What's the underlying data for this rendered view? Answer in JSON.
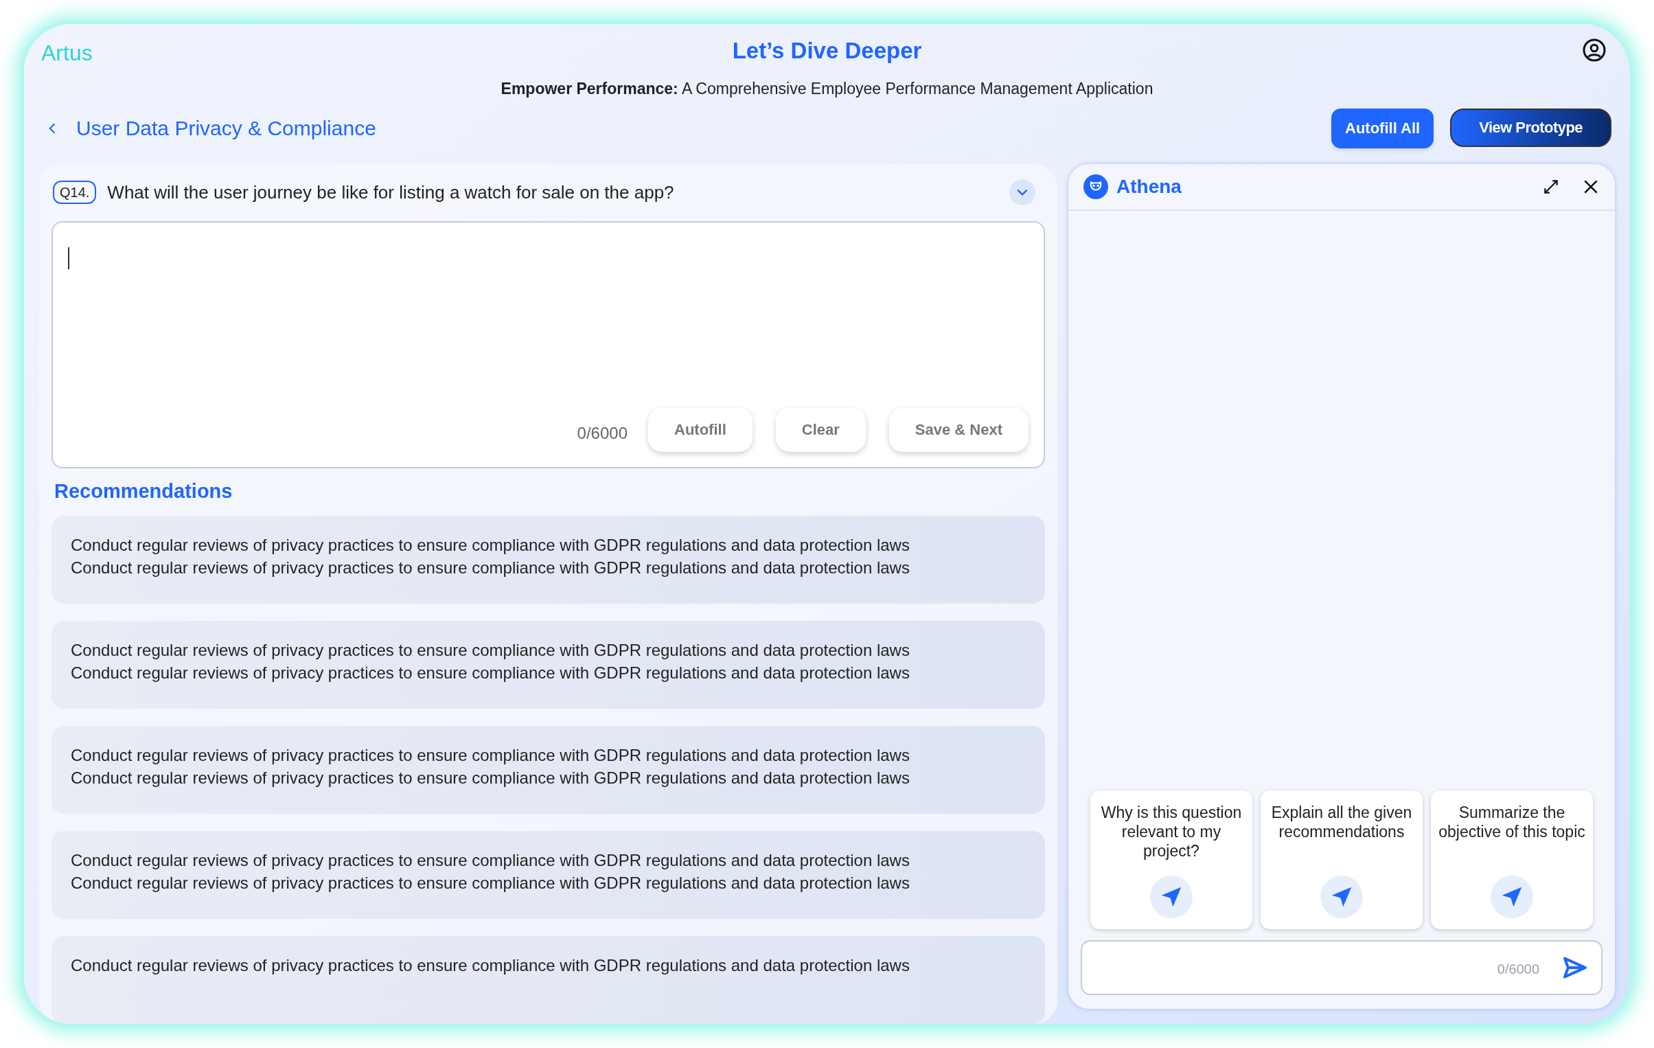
{
  "header": {
    "logo": "Artus",
    "title": "Let’s Dive Deeper",
    "subtitle": "**Empower Performance:** A Comprehensive Employee Performance Management Application"
  },
  "breadcrumb": {
    "label": "User Data Privacy & Compliance"
  },
  "actions": [
    {
      "label": "Autofill All",
      "kind": "solid"
    },
    {
      "label": "View Prototype",
      "kind": "gradient"
    }
  ],
  "question": {
    "number": "Q14.",
    "text": "What will the user journey be like for listing a watch for sale on the app?"
  },
  "answer": {
    "counter": "0/6000",
    "buttons": [
      "Autofill",
      "Clear",
      "Save & Next"
    ]
  },
  "recommendations": {
    "title": "Recommendations",
    "items": [
      {
        "lines": [
          "Conduct regular reviews of privacy practices to ensure compliance with GDPR regulations and data protection laws",
          "Conduct regular reviews of privacy practices to ensure compliance with GDPR regulations and data protection laws"
        ]
      },
      {
        "lines": [
          "Conduct regular reviews of privacy practices to ensure compliance with GDPR regulations and data protection laws",
          "Conduct regular reviews of privacy practices to ensure compliance with GDPR regulations and data protection laws"
        ]
      },
      {
        "lines": [
          "Conduct regular reviews of privacy practices to ensure compliance with GDPR regulations and data protection laws",
          "Conduct regular reviews of privacy practices to ensure compliance with GDPR regulations and data protection laws"
        ]
      },
      {
        "lines": [
          "Conduct regular reviews of privacy practices to ensure compliance with GDPR regulations and data protection laws",
          "Conduct regular reviews of privacy practices to ensure compliance with GDPR regulations and data protection laws"
        ]
      },
      {
        "lines": [
          "Conduct regular reviews of privacy practices to ensure compliance with GDPR regulations and data protection laws"
        ]
      }
    ]
  },
  "assistant": {
    "title": "Athena",
    "suggestions": [
      "Why is this question relevant to my project?",
      "Explain all the given recommendations",
      "Summarize the objective of this topic"
    ],
    "input": {
      "counter": "0/6000"
    }
  }
}
